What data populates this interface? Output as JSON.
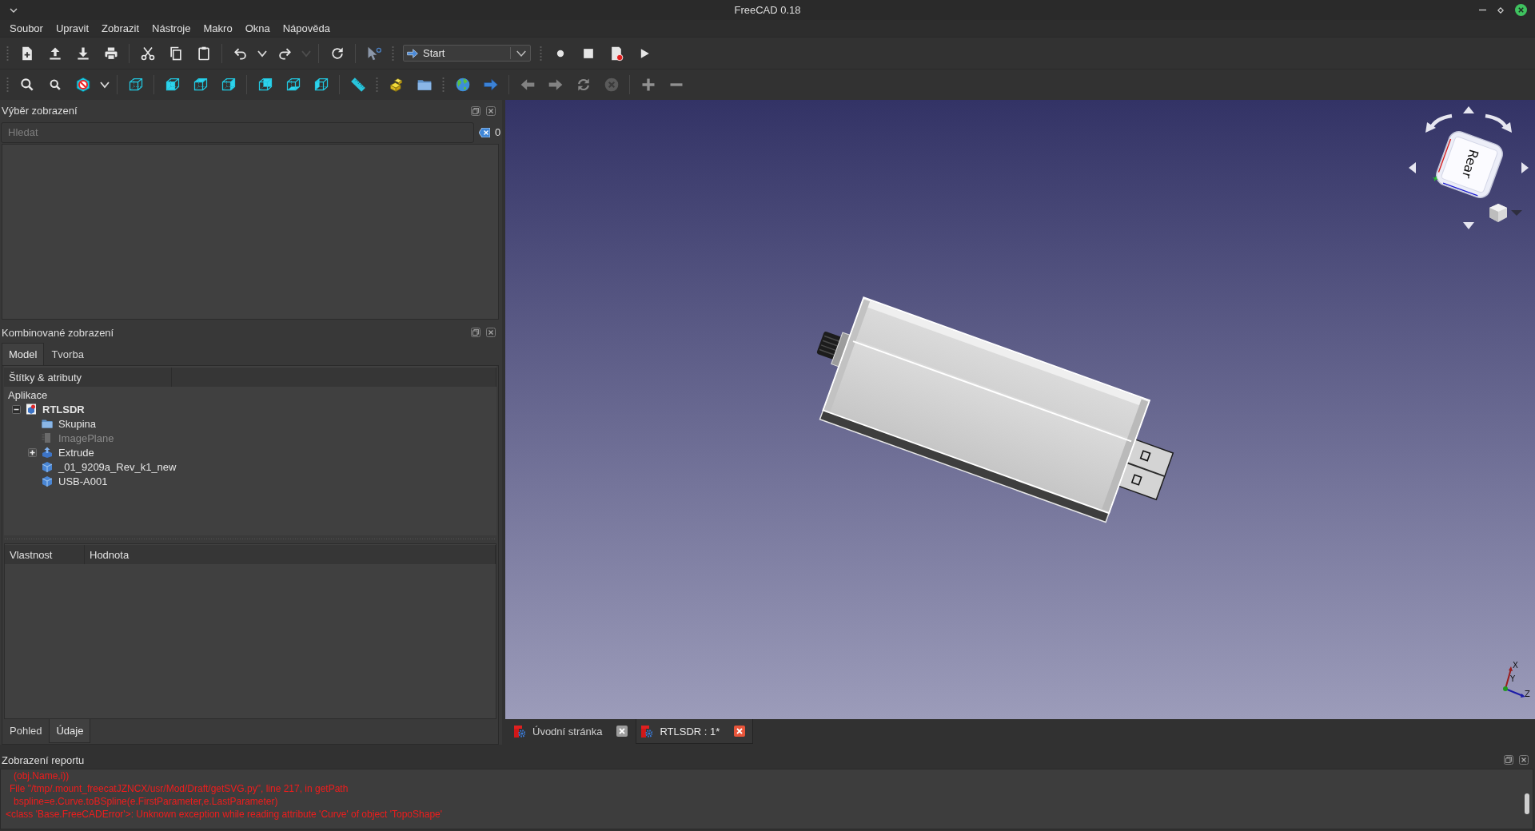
{
  "window": {
    "title": "FreeCAD 0.18"
  },
  "menu": [
    "Soubor",
    "Upravit",
    "Zobrazit",
    "Nástroje",
    "Makro",
    "Okna",
    "Nápověda"
  ],
  "toolbar_rows": [
    {
      "toolbars": [
        {
          "groups": [
            [
              {
                "kind": "new-file",
                "disabled": false
              },
              {
                "kind": "open",
                "disabled": false
              },
              {
                "kind": "save",
                "disabled": false
              },
              {
                "kind": "print",
                "disabled": false
              }
            ],
            [
              {
                "kind": "cut",
                "disabled": false
              },
              {
                "kind": "copy",
                "disabled": false
              },
              {
                "kind": "paste",
                "disabled": false
              }
            ],
            [
              {
                "kind": "undo",
                "disabled": false
              },
              {
                "kind": "dropdown",
                "disabled": false
              },
              {
                "kind": "redo",
                "disabled": false
              },
              {
                "kind": "dropdown",
                "disabled": true
              }
            ],
            [
              {
                "kind": "refresh",
                "disabled": false
              }
            ],
            [
              {
                "kind": "whats-this",
                "disabled": false
              }
            ]
          ]
        },
        {
          "groups": [
            [
              {
                "kind": "workbench",
                "value": "Start",
                "disabled": false
              }
            ]
          ]
        },
        {
          "groups": [
            [
              {
                "kind": "record",
                "disabled": false
              },
              {
                "kind": "stop",
                "disabled": false
              },
              {
                "kind": "macro",
                "disabled": false
              },
              {
                "kind": "play",
                "disabled": false
              }
            ]
          ]
        }
      ]
    },
    {
      "toolbars": [
        {
          "groups": [
            [
              {
                "kind": "zoom-all",
                "disabled": false
              },
              {
                "kind": "zoom-selection",
                "disabled": false
              },
              {
                "kind": "draw-style",
                "disabled": false
              },
              {
                "kind": "dropdown",
                "disabled": false
              }
            ],
            [
              {
                "kind": "view-iso",
                "disabled": false
              }
            ],
            [
              {
                "kind": "view-front",
                "disabled": false
              },
              {
                "kind": "view-top",
                "disabled": false
              },
              {
                "kind": "view-right",
                "disabled": false
              }
            ],
            [
              {
                "kind": "view-rear",
                "disabled": false
              },
              {
                "kind": "view-bottom",
                "disabled": false
              },
              {
                "kind": "view-left",
                "disabled": false
              }
            ],
            [
              {
                "kind": "measure",
                "disabled": false
              }
            ]
          ]
        },
        {
          "groups": [
            [
              {
                "kind": "part",
                "disabled": false
              },
              {
                "kind": "folder",
                "disabled": false
              }
            ]
          ]
        },
        {
          "groups": [
            [
              {
                "kind": "globe",
                "disabled": false
              },
              {
                "kind": "go",
                "disabled": false
              }
            ],
            [
              {
                "kind": "back",
                "disabled": true
              },
              {
                "kind": "forward",
                "disabled": true
              },
              {
                "kind": "reload",
                "disabled": true
              },
              {
                "kind": "stop-load",
                "disabled": true
              }
            ],
            [
              {
                "kind": "zoom-in",
                "disabled": true
              },
              {
                "kind": "zoom-out",
                "disabled": true
              }
            ]
          ]
        }
      ]
    }
  ],
  "selection_view": {
    "title": "Výběr zobrazení",
    "search": {
      "placeholder": "Hledat"
    },
    "count": "0"
  },
  "combo_view": {
    "title": "Kombinované zobrazení",
    "tabs": [
      {
        "label": "Model",
        "selected": true
      },
      {
        "label": "Tvorba",
        "selected": false
      }
    ],
    "tree": {
      "header": "Štítky & atributy",
      "root": "Aplikace",
      "items": [
        {
          "label": "RTLSDR",
          "kind": "document",
          "expandable": true,
          "expanded": true,
          "hidden": false,
          "children": [
            {
              "label": "Skupina",
              "kind": "folder",
              "expandable": false,
              "hidden": false
            },
            {
              "label": "ImagePlane",
              "kind": "image-plane",
              "expandable": false,
              "hidden": true
            },
            {
              "label": "Extrude",
              "kind": "extrude",
              "expandable": true,
              "expanded": false,
              "hidden": false
            },
            {
              "label": "_01_9209a_Rev_k1_new",
              "kind": "solid",
              "expandable": false,
              "hidden": false
            },
            {
              "label": "USB-A001",
              "kind": "solid",
              "expandable": false,
              "hidden": false
            }
          ]
        }
      ]
    },
    "property_view": {
      "columns": [
        "Vlastnost",
        "Hodnota"
      ]
    },
    "bottom_tabs": [
      {
        "label": "Pohled",
        "selected": false
      },
      {
        "label": "Údaje",
        "selected": true
      }
    ]
  },
  "viewport": {
    "nav_cube": {
      "face": "Rear"
    },
    "axes": [
      "X",
      "Y",
      "Z"
    ]
  },
  "document_tabs": [
    {
      "label": "Úvodní stránka",
      "selected": false
    },
    {
      "label": "RTLSDR : 1*",
      "selected": true
    }
  ],
  "report_view": {
    "title": "Zobrazení reportu",
    "lines": [
      {
        "kind": "code",
        "text": "(obj.Name,i))"
      },
      {
        "kind": "frame",
        "text": "File \"/tmp/.mount_freecatJZNCX/usr/Mod/Draft/getSVG.py\", line 217, in getPath"
      },
      {
        "kind": "code",
        "text": "bspline=e.Curve.toBSpline(e.FirstParameter,e.LastParameter)"
      },
      {
        "kind": "error",
        "text": "<class 'Base.FreeCADError'>: Unknown exception while reading attribute 'Curve' of object 'TopoShape'"
      }
    ]
  }
}
